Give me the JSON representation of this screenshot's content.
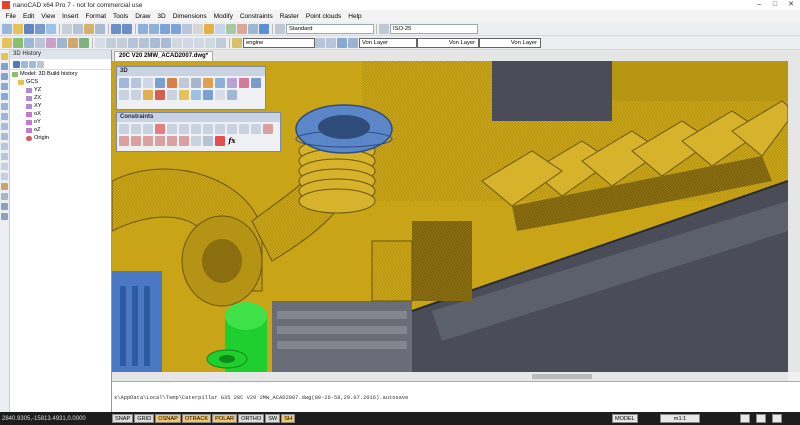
{
  "window": {
    "title": "nanoCAD x64 Pro 7 - not for commercial use"
  },
  "menu": [
    "File",
    "Edit",
    "View",
    "Insert",
    "Format",
    "Tools",
    "Draw",
    "3D",
    "Dimensions",
    "Modify",
    "Constraints",
    "Raster",
    "Point clouds",
    "Help"
  ],
  "toolbar": {
    "text_style": "Standard",
    "dim_style": "ISO-25",
    "layer": "engine",
    "color": "Von Layer",
    "linetype": "Von Layer",
    "lineweight": "Von Layer"
  },
  "history_panel": {
    "title": "3D History",
    "tree": [
      {
        "label": "Model: 3D Build history",
        "level": 0,
        "icon": "model-icon"
      },
      {
        "label": "GCS",
        "level": 1,
        "icon": "folder-icon"
      },
      {
        "label": "YZ",
        "level": 2,
        "icon": "plane-icon"
      },
      {
        "label": "ZX",
        "level": 2,
        "icon": "plane-icon"
      },
      {
        "label": "XY",
        "level": 2,
        "icon": "plane-icon"
      },
      {
        "label": "oX",
        "level": 2,
        "icon": "axis-icon"
      },
      {
        "label": "oY",
        "level": 2,
        "icon": "axis-icon"
      },
      {
        "label": "oZ",
        "level": 2,
        "icon": "axis-icon"
      },
      {
        "label": "Origin",
        "level": 2,
        "icon": "origin-icon"
      }
    ]
  },
  "document": {
    "tab": "20C V20 2MW_ACAD2007.dwg*"
  },
  "panels": {
    "three_d": "3D",
    "constraints": "Constraints",
    "fx": "fx"
  },
  "command_line": [
    "s\\AppData\\Local\\Temp\\Caterpillar G35 20C V20 2MW_ACAD2007.dwg(09-26-58,29.07.2016).autosave"
  ],
  "status": {
    "coords": "2840.9305,-15813.4931,0.0000",
    "toggles": [
      {
        "label": "SNAP",
        "on": false
      },
      {
        "label": "GRID",
        "on": false
      },
      {
        "label": "OSNAP",
        "on": true
      },
      {
        "label": "OTRACK",
        "on": true
      },
      {
        "label": "POLAR",
        "on": true
      },
      {
        "label": "ORTHO",
        "on": false
      },
      {
        "label": "SW",
        "on": false
      },
      {
        "label": "SH",
        "on": true
      }
    ],
    "mode": "MODEL",
    "scale": "m1:1"
  },
  "colors": {
    "engine_yellow": "#c9a417",
    "flange_blue": "#5b86c8",
    "part_green": "#1fcf2f",
    "housing_gray": "#4a4d57",
    "status_on": "#f4c66c"
  }
}
